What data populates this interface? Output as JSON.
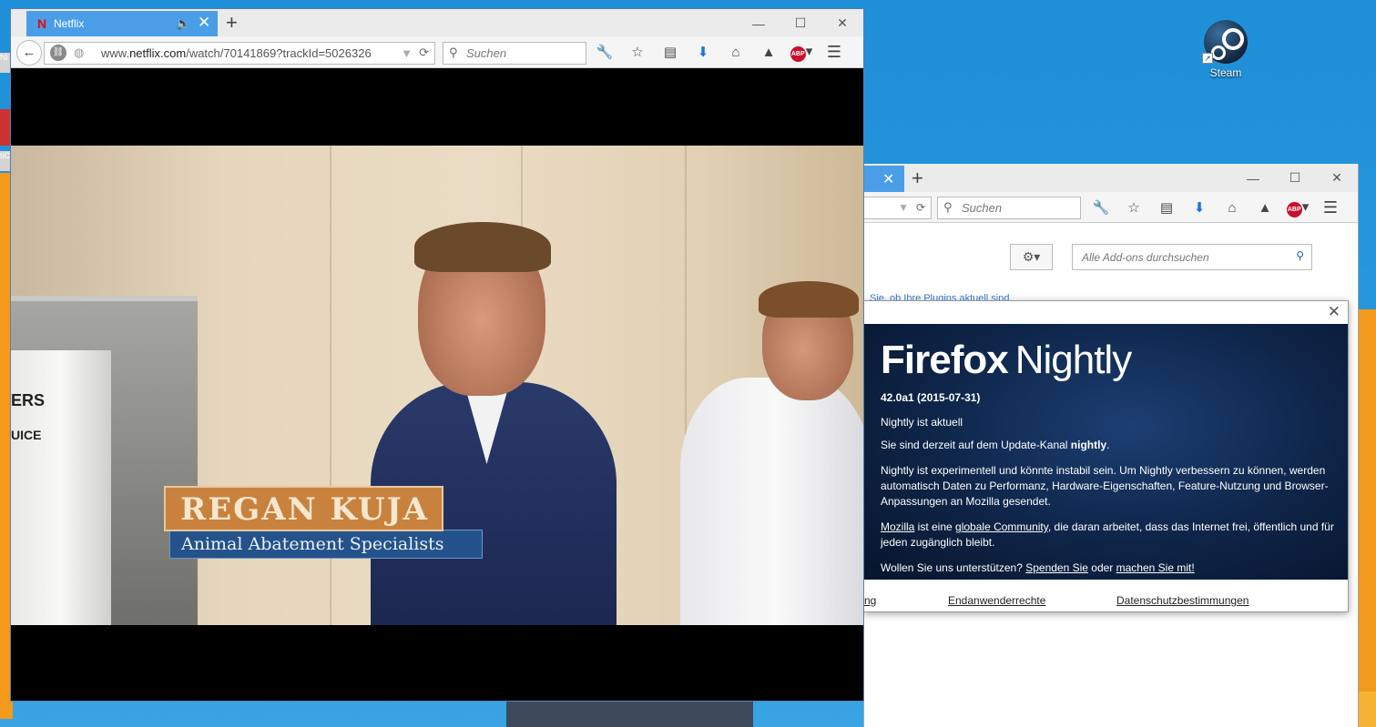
{
  "desktop": {
    "steam_label": "Steam",
    "left_icon_labels": [
      "Ni",
      "tiC"
    ]
  },
  "front_window": {
    "tab": {
      "title": "Netflix",
      "favicon": "N"
    },
    "url": {
      "prefix": "www.",
      "domain": "netflix.com",
      "path": "/watch/70141869?trackId=5026326"
    },
    "search_placeholder": "Suchen",
    "video": {
      "name_caption": "REGAN KUJA",
      "title_caption": "Animal Abatement Specialists",
      "bucket_text_1": "ERS",
      "bucket_text_2": "UICE"
    }
  },
  "back_window": {
    "search_placeholder": "Suchen",
    "addons_search_placeholder": "Alle Add-ons durchsuchen",
    "plugin_check_hint": "Sie, ob Ihre Plugins aktuell sind"
  },
  "about_dialog": {
    "logo_bold": "Firefox",
    "logo_light": "Nightly",
    "version": "42.0a1 (2015-07-31)",
    "status": "Nightly ist aktuell",
    "channel_text": "Sie sind derzeit auf dem Update-Kanal ",
    "channel_name": "nightly",
    "channel_end": ".",
    "experimental_text": "Nightly ist experimentell und könnte instabil sein. Um Nightly verbessern zu können, werden automatisch Daten zu Performanz, Hardware-Eigenschaften, Feature-Nutzung und Browser-Anpassungen an Mozilla gesendet.",
    "mozilla_link": "Mozilla",
    "mozilla_mid": " ist eine ",
    "community_link": "globale Community",
    "community_end": ", die daran arbeitet, dass das Internet frei, öffentlich und für jeden zugänglich bleibt.",
    "support_text": "Wollen Sie uns unterstützen? ",
    "donate_link": "Spenden Sie",
    "support_mid": " oder ",
    "participate_link": "machen Sie mit!",
    "footer_links": [
      "ng",
      "Endanwenderrechte",
      "Datenschutzbestimmungen"
    ]
  },
  "colors": {
    "tab_active": "#4a9ee8",
    "netflix_red": "#e50914",
    "desktop_blue": "#2a9ae0",
    "desktop_orange": "#f39a1c",
    "nightly_bg": "#0e2447"
  },
  "icons": {
    "toolbar": [
      "wrench-icon",
      "star-icon",
      "clipboard-icon",
      "download-icon",
      "home-icon",
      "pocket-icon",
      "adblock-plus-icon",
      "menu-icon"
    ]
  }
}
